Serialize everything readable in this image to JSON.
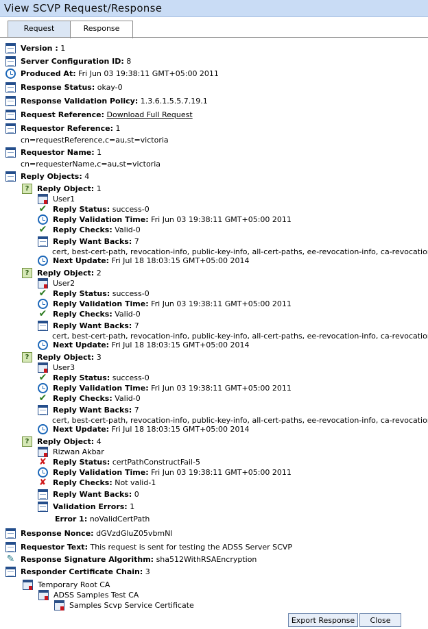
{
  "window_title": "View SCVP Request/Response",
  "tabs": [
    "Request",
    "Response"
  ],
  "fields": {
    "version": {
      "label": "Version :",
      "value": "1"
    },
    "server_config": {
      "label": "Server Configuration ID:",
      "value": "8"
    },
    "produced_at": {
      "label": "Produced At:",
      "value": "Fri Jun 03 19:38:11 GMT+05:00 2011"
    },
    "response_status": {
      "label": "Response Status:",
      "value": "okay-0"
    },
    "validation_policy": {
      "label": "Response Validation Policy:",
      "value": "1.3.6.1.5.5.7.19.1"
    },
    "request_reference": {
      "label": "Request Reference:",
      "value": "Download Full Request"
    },
    "requestor_reference": {
      "label": "Requestor Reference:",
      "value": "1",
      "detail": "cn=requestReference,c=au,st=victoria"
    },
    "requestor_name": {
      "label": "Requestor Name:",
      "value": "1",
      "detail": "cn=requesterName,c=au,st=victoria"
    },
    "reply_objects": {
      "label": "Reply Objects:",
      "value": "4"
    }
  },
  "labels": {
    "reply_object": "Reply Object:",
    "reply_status": "Reply Status:",
    "reply_validation_time": "Reply Validation Time:",
    "reply_checks": "Reply Checks:",
    "reply_want_backs": "Reply Want Backs:",
    "next_update": "Next Update:",
    "validation_errors": "Validation Errors:",
    "error_1": "Error 1:"
  },
  "reply_objects": [
    {
      "index": "1",
      "user": "User1",
      "status": "success-0",
      "time": "Fri Jun 03 19:38:11 GMT+05:00 2011",
      "checks": "Valid-0",
      "want_backs": "7",
      "want_backs_list": "cert, best-cert-path, revocation-info, public-key-info, all-cert-paths, ee-revocation-info, ca-revocation-info",
      "next_update": "Fri Jul 18 18:03:15 GMT+05:00 2014"
    },
    {
      "index": "2",
      "user": "User2",
      "status": "success-0",
      "time": "Fri Jun 03 19:38:11 GMT+05:00 2011",
      "checks": "Valid-0",
      "want_backs": "7",
      "want_backs_list": "cert, best-cert-path, revocation-info, public-key-info, all-cert-paths, ee-revocation-info, ca-revocation-info",
      "next_update": "Fri Jul 18 18:03:15 GMT+05:00 2014"
    },
    {
      "index": "3",
      "user": "User3",
      "status": "success-0",
      "time": "Fri Jun 03 19:38:11 GMT+05:00 2011",
      "checks": "Valid-0",
      "want_backs": "7",
      "want_backs_list": "cert, best-cert-path, revocation-info, public-key-info, all-cert-paths, ee-revocation-info, ca-revocation-info",
      "next_update": "Fri Jul 18 18:03:15 GMT+05:00 2014"
    },
    {
      "index": "4",
      "user": "Rizwan Akbar",
      "status": "certPathConstructFail-5",
      "time": "Fri Jun 03 19:38:11 GMT+05:00 2011",
      "checks": "Not valid-1",
      "want_backs": "0",
      "validation_errors": "1",
      "error_1": "noValidCertPath"
    }
  ],
  "footer_fields": {
    "response_nonce": {
      "label": "Response Nonce:",
      "value": "dGVzdGluZ05vbmNl"
    },
    "requestor_text": {
      "label": "Requestor Text:",
      "value": "This request is sent for testing the ADSS Server SCVP"
    },
    "signature_algorithm": {
      "label": "Response Signature Algorithm:",
      "value": "sha512WithRSAEncryption"
    },
    "cert_chain": {
      "label": "Responder Certificate Chain:",
      "value": "3"
    }
  },
  "cert_chain": [
    "Temporary Root CA",
    "ADSS Samples Test CA",
    "Samples Scvp Service Certificate"
  ],
  "buttons": {
    "export": "Export Response",
    "close": "Close"
  },
  "icons": [
    "doc-icon",
    "clock-icon",
    "question-icon",
    "check-icon",
    "cross-icon",
    "certificate-icon",
    "signature-icon"
  ]
}
